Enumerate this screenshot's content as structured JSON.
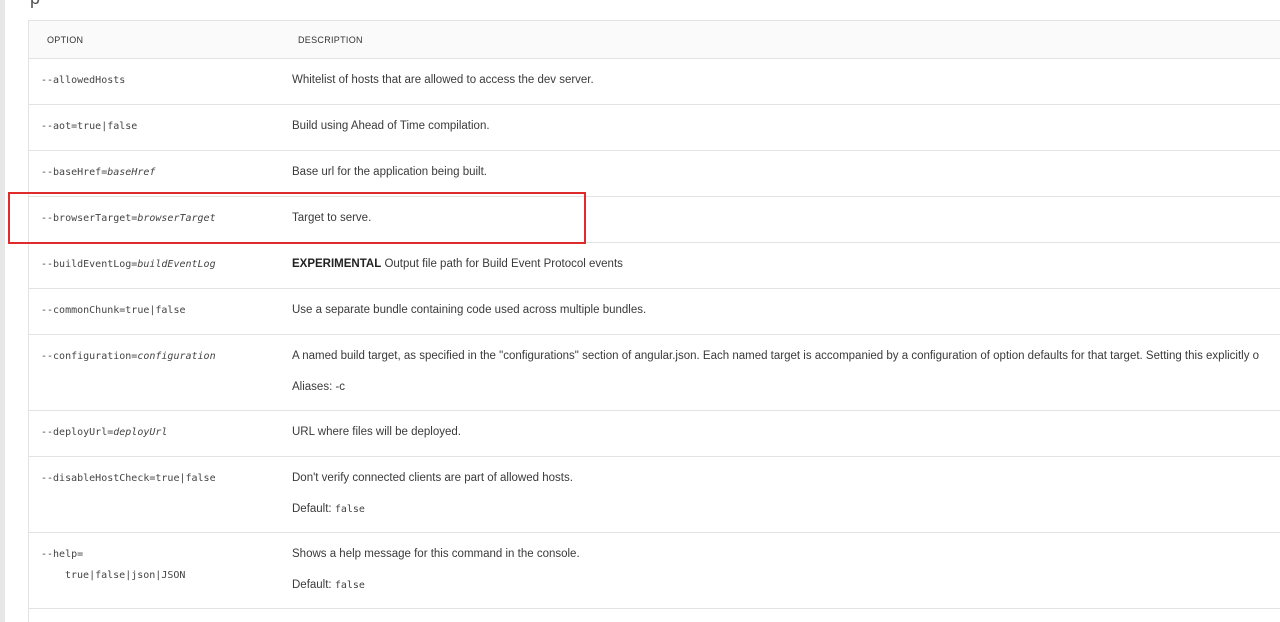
{
  "header": {
    "option": "OPTION",
    "description": "DESCRIPTION"
  },
  "top_fragment": "p",
  "rows": [
    {
      "opt_prefix": "--allowedHosts",
      "opt_italic": "",
      "desc": "Whitelist of hosts that are allowed to access the dev server."
    },
    {
      "opt_prefix": "--aot=true|false",
      "opt_italic": "",
      "desc": "Build using Ahead of Time compilation."
    },
    {
      "opt_prefix": "--baseHref=",
      "opt_italic": "baseHref",
      "desc": "Base url for the application being built."
    },
    {
      "opt_prefix": "--browserTarget=",
      "opt_italic": "browserTarget",
      "desc": "Target to serve."
    },
    {
      "opt_prefix": "--buildEventLog=",
      "opt_italic": "buildEventLog",
      "desc_bold": "EXPERIMENTAL",
      "desc": " Output file path for Build Event Protocol events"
    },
    {
      "opt_prefix": "--commonChunk=true|false",
      "opt_italic": "",
      "desc": "Use a separate bundle containing code used across multiple bundles."
    },
    {
      "opt_prefix": "--configuration=",
      "opt_italic": "configuration",
      "desc": "A named build target, as specified in the \"configurations\" section of angular.json. Each named target is accompanied by a configuration of option defaults for that target. Setting this explicitly o",
      "sub": "Aliases: -c"
    },
    {
      "opt_prefix": "--deployUrl=",
      "opt_italic": "deployUrl",
      "desc": "URL where files will be deployed."
    },
    {
      "opt_prefix": "--disableHostCheck=true|false",
      "opt_italic": "",
      "desc": "Don't verify connected clients are part of allowed hosts.",
      "sub_label": "Default: ",
      "sub_code": "false"
    },
    {
      "opt_prefix": "--help=",
      "opt_line2": "true|false|json|JSON",
      "opt_italic": "",
      "desc": "Shows a help message for this command in the console.",
      "sub_label": "Default: ",
      "sub_code": "false"
    }
  ],
  "highlight_color": "#e02b2b"
}
